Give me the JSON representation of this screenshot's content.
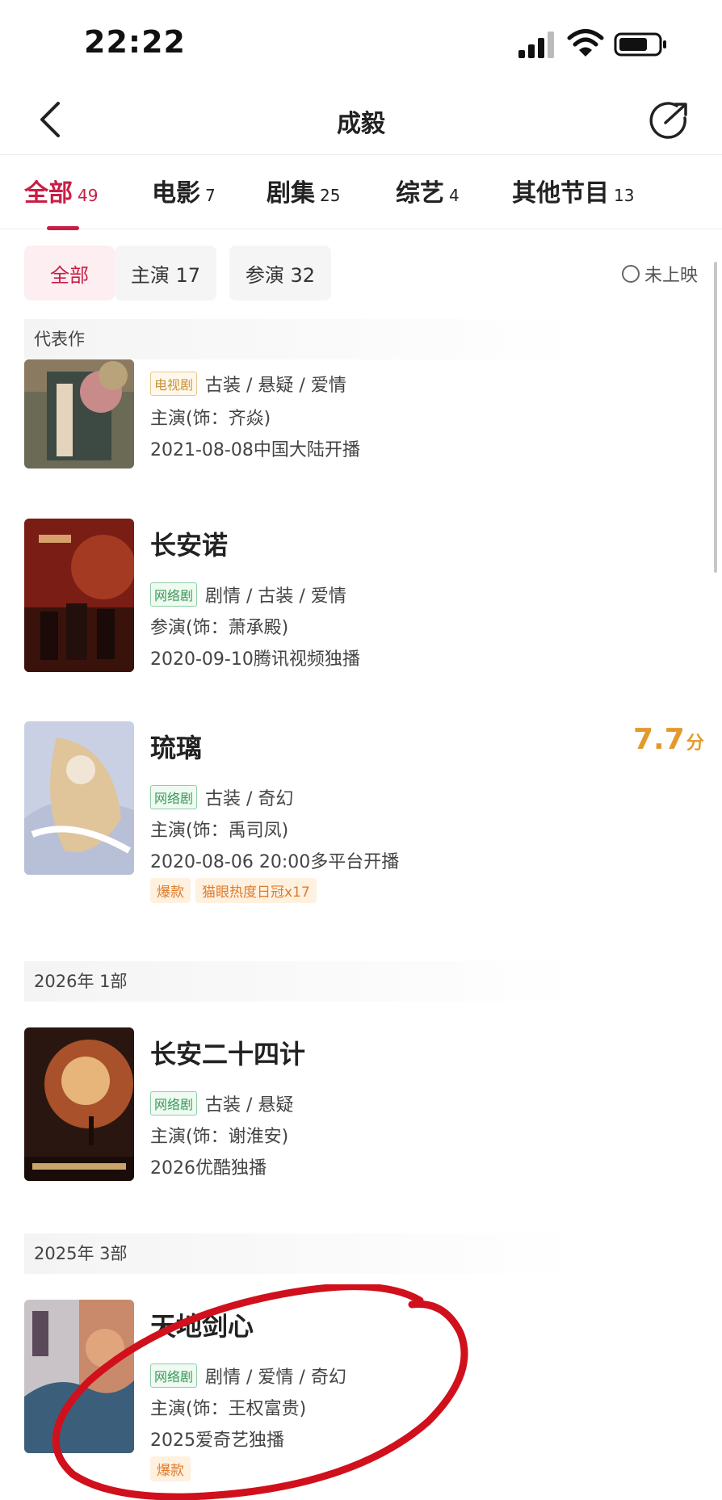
{
  "status_bar": {
    "time": "22:22"
  },
  "nav": {
    "title": "成毅"
  },
  "tabs": [
    {
      "label": "全部",
      "count": "49"
    },
    {
      "label": "电影",
      "count": "7"
    },
    {
      "label": "剧集",
      "count": "25"
    },
    {
      "label": "综艺",
      "count": "4"
    },
    {
      "label": "其他节目",
      "count": "13"
    }
  ],
  "filters": [
    {
      "label": "全部"
    },
    {
      "label": "主演 17"
    },
    {
      "label": "参演 32"
    }
  ],
  "unreleased_label": "未上映",
  "sections": {
    "featured": "代表作",
    "y2026": "2026年 1部",
    "y2025": "2025年 3部"
  },
  "movies": [
    {
      "title": "",
      "platform": "电视剧",
      "genres": "古装 / 悬疑 / 爱情",
      "role": "主演(饰：齐焱)",
      "release": "2021-08-08中国大陆开播"
    },
    {
      "title": "长安诺",
      "platform": "网络剧",
      "genres": "剧情 / 古装 / 爱情",
      "role": "参演(饰：萧承殿)",
      "release": "2020-09-10腾讯视频独播"
    },
    {
      "title": "琉璃",
      "platform": "网络剧",
      "genres": "古装 / 奇幻",
      "role": "主演(饰：禹司凤)",
      "release": "2020-08-06 20:00多平台开播",
      "rating": "7.7",
      "rating_unit": "分",
      "tags": [
        "爆款",
        "猫眼热度日冠x17"
      ]
    },
    {
      "title": "长安二十四计",
      "platform": "网络剧",
      "genres": "古装 / 悬疑",
      "role": "主演(饰：谢淮安)",
      "release": "2026优酷独播"
    },
    {
      "title": "天地剑心",
      "platform": "网络剧",
      "genres": "剧情 / 爱情 / 奇幻",
      "role": "主演(饰：王权富贵)",
      "release": "2025爱奇艺独播",
      "tags": [
        "爆款"
      ]
    }
  ],
  "colors": {
    "accent": "#c81e45",
    "rating": "#e39a2a",
    "annotation": "#d0101c"
  }
}
